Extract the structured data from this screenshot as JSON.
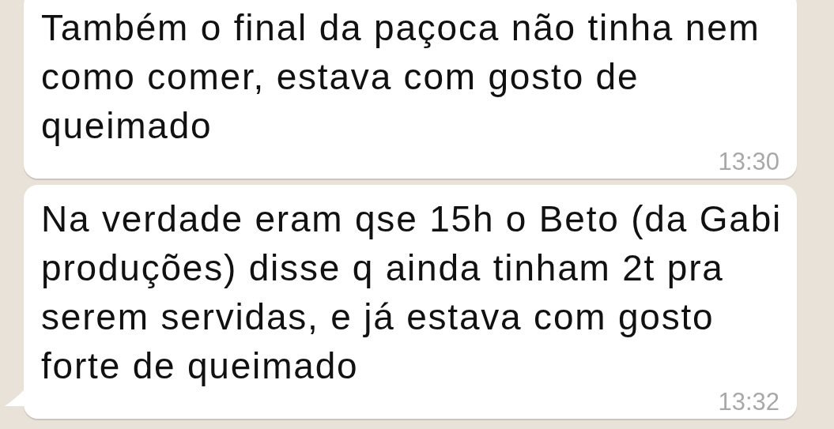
{
  "messages": [
    {
      "text": "Também o final da paçoca não tinha nem como comer, estava com gosto de queimado",
      "time": "13:30",
      "tail": false
    },
    {
      "text": "Na verdade eram qse 15h o Beto (da Gabi produções) disse q ainda tinham 2t pra serem servidas, e já estava com gosto forte de queimado",
      "time": "13:32",
      "tail": true
    }
  ]
}
